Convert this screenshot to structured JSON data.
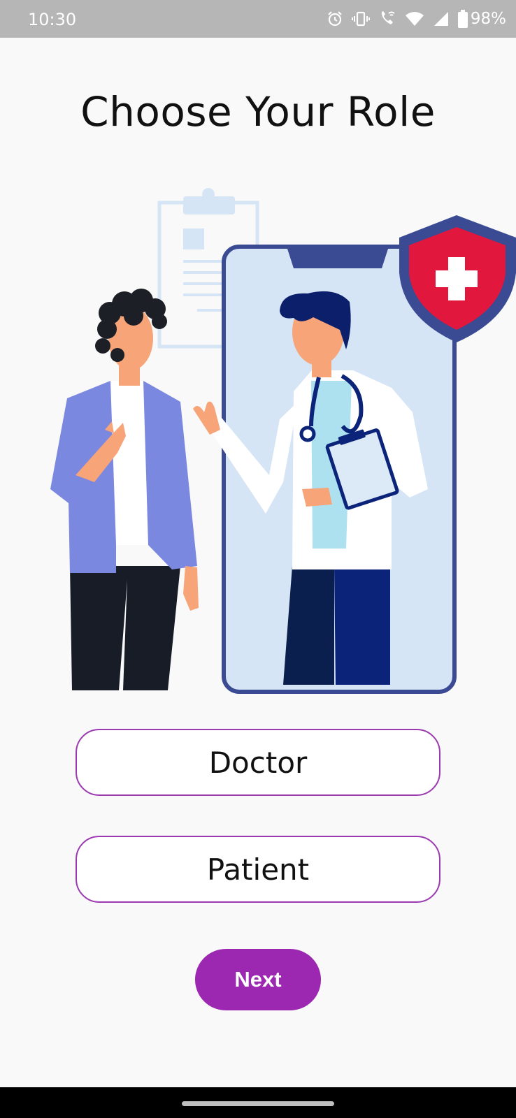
{
  "status_bar": {
    "time": "10:30",
    "battery": "98%",
    "icons": [
      "alarm-icon",
      "vibrate-icon",
      "wifi-calling-icon",
      "wifi-icon",
      "signal-icon",
      "battery-icon"
    ]
  },
  "title": "Choose Your Role",
  "illustration": {
    "icon": "doctor-patient-illustration"
  },
  "roles": {
    "doctor": "Doctor",
    "patient": "Patient"
  },
  "next_label": "Next",
  "colors": {
    "accent": "#9c27b0",
    "button_border": "#9b3ab0",
    "background": "#f9f9f9",
    "status_bar": "#b6b6b6"
  }
}
